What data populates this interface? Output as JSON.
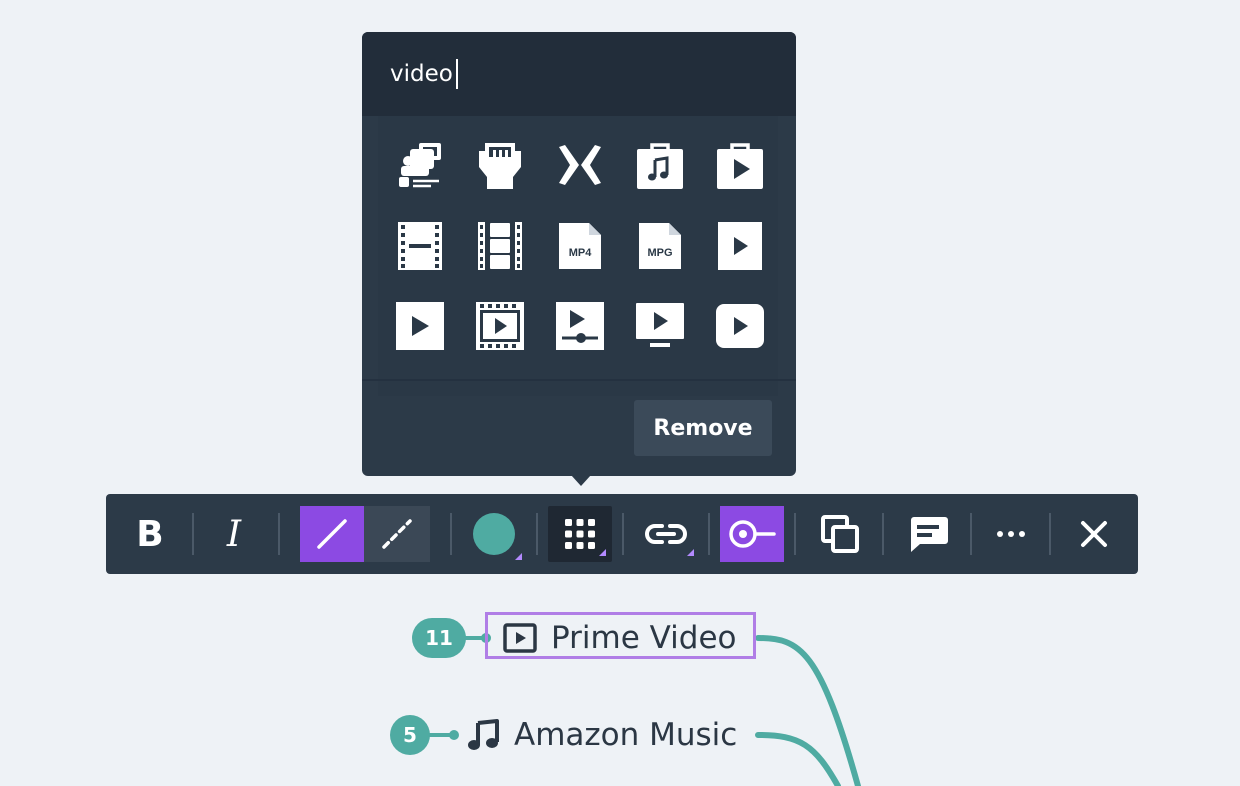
{
  "icon_picker": {
    "search_value": "video",
    "icons": [
      "camera-video-person-icon",
      "hdmi-port-icon",
      "mixer-logo-icon",
      "music-store-bag-icon",
      "video-store-bag-icon",
      "film-strip-minus-icon",
      "film-strip-frames-icon",
      "mp4-file-icon",
      "mpg-file-icon",
      "play-square-small-icon",
      "play-square-icon",
      "film-play-icon",
      "video-settings-slider-icon",
      "video-monitor-play-icon",
      "play-rounded-box-icon"
    ],
    "mp4_label": "MP4",
    "mpg_label": "MPG",
    "remove_label": "Remove"
  },
  "toolbar": {
    "bold_label": "B",
    "italic_label": "I",
    "color_swatch": "#4faba2",
    "active_color": "#8c4ae3"
  },
  "nodes": [
    {
      "label": "Prime Video",
      "badge": "11",
      "icon": "video-player-icon"
    },
    {
      "label": "Amazon Music",
      "badge": "5",
      "icon": "music-note-icon"
    }
  ],
  "colors": {
    "branch": "#4faba2",
    "selection": "#b07ee6"
  }
}
